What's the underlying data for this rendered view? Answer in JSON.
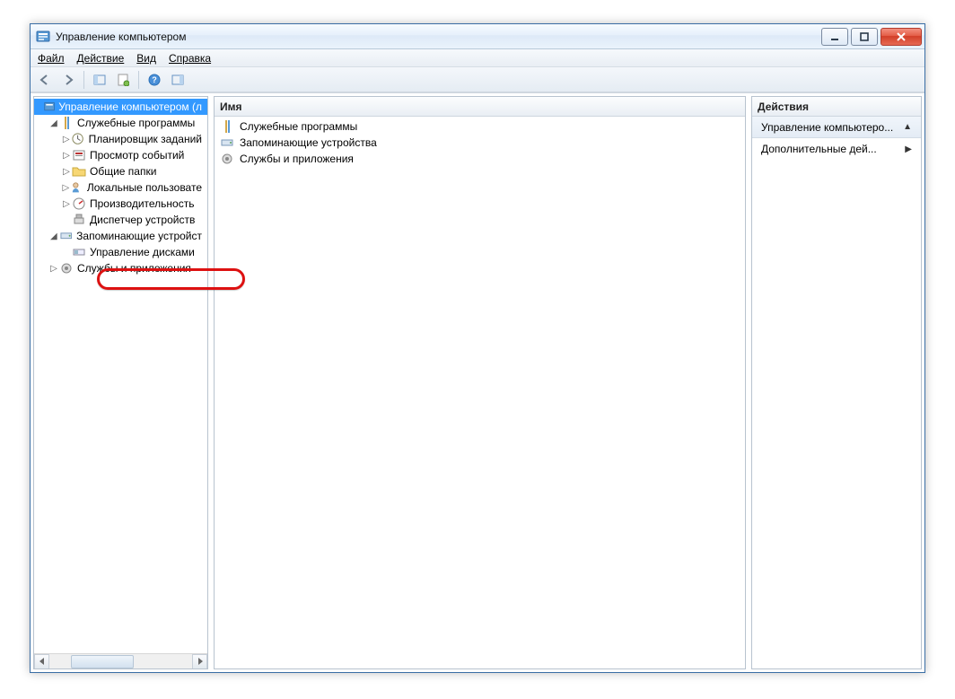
{
  "window": {
    "title": "Управление компьютером"
  },
  "menu": {
    "file": "Файл",
    "action": "Действие",
    "view": "Вид",
    "help": "Справка"
  },
  "columns": {
    "name": "Имя",
    "actions": "Действия"
  },
  "actions": {
    "header": "Управление компьютеро...",
    "more": "Дополнительные дей..."
  },
  "tree": {
    "root": "Управление компьютером (л",
    "system_tools": "Служебные программы",
    "task_scheduler": "Планировщик заданий",
    "event_viewer": "Просмотр событий",
    "shared_folders": "Общие папки",
    "local_users": "Локальные пользовате",
    "performance": "Производительность",
    "device_manager": "Диспетчер устройств",
    "storage": "Запоминающие устройст",
    "disk_management": "Управление дисками",
    "services_apps": "Службы и приложения"
  },
  "list": {
    "items": [
      {
        "label": "Служебные программы",
        "icon": "tools"
      },
      {
        "label": "Запоминающие устройства",
        "icon": "storage"
      },
      {
        "label": "Службы и приложения",
        "icon": "gear"
      }
    ]
  }
}
